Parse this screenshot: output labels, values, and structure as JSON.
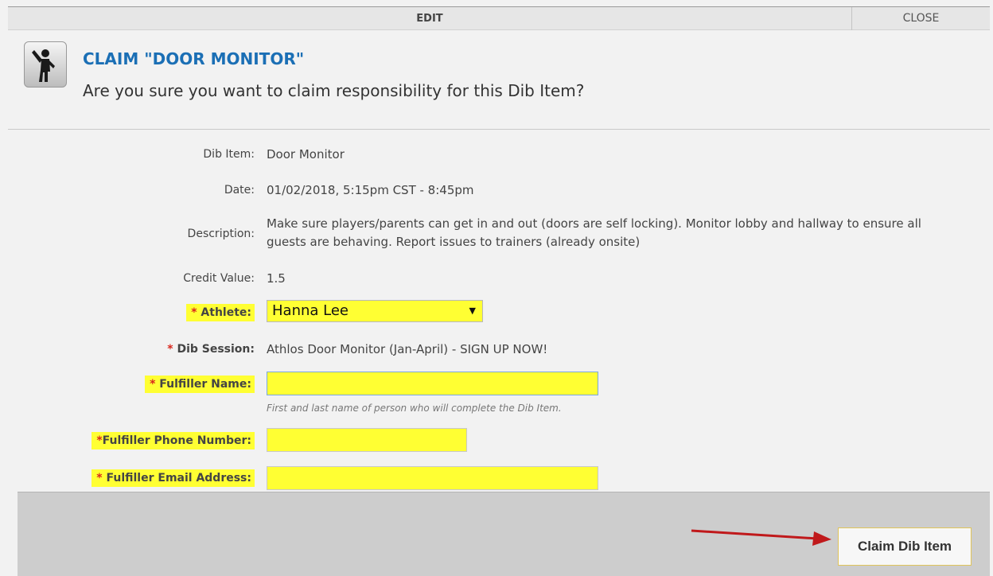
{
  "topbar": {
    "edit_label": "EDIT",
    "close_label": "CLOSE"
  },
  "header": {
    "title": "CLAIM \"DOOR MONITOR\"",
    "question": "Are you sure you want to claim responsibility for this Dib Item?",
    "icon": "person-waving-icon"
  },
  "fields": {
    "dib_item": {
      "label": "Dib Item:",
      "value": "Door Monitor"
    },
    "date": {
      "label": "Date:",
      "value": "01/02/2018, 5:15pm CST - 8:45pm"
    },
    "description": {
      "label": "Description:",
      "value": "Make sure players/parents can get in and out (doors are self locking). Monitor lobby and hallway to ensure all guests are behaving. Report issues to trainers (already onsite)"
    },
    "credit_value": {
      "label": "Credit Value:",
      "value": "1.5"
    },
    "athlete": {
      "label": "Athlete:",
      "selected": "Hanna Lee"
    },
    "dib_session": {
      "label": "Dib Session:",
      "value": "Athlos Door Monitor (Jan-April) - SIGN UP NOW!"
    },
    "fulfiller_name": {
      "label": "Fulfiller Name:",
      "value": "",
      "help": "First and last name of person who will complete the Dib Item."
    },
    "fulfiller_phone": {
      "label": "Fulfiller Phone Number:",
      "value": ""
    },
    "fulfiller_email": {
      "label": "Fulfiller Email Address:",
      "value": ""
    }
  },
  "required_marker": "*",
  "footer": {
    "claim_label": "Claim Dib Item"
  },
  "colors": {
    "highlight": "#ffff33",
    "title_blue": "#1b6fb5",
    "required_red": "#d9271d",
    "arrow_red": "#c0191b"
  }
}
